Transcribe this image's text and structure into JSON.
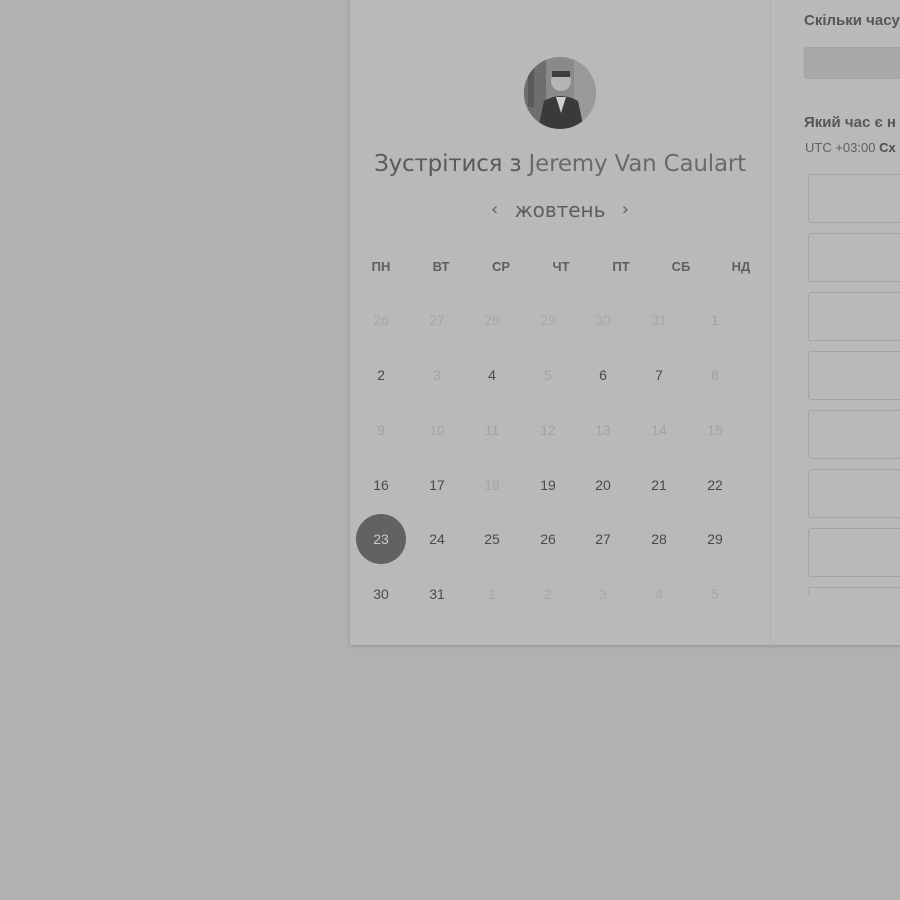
{
  "meeting": {
    "title_prefix": "Зустрітися з",
    "host_name": "Jeremy Van Caulart"
  },
  "calendar": {
    "month_label": "жовтень",
    "prev_icon": "‹",
    "next_icon": "›",
    "weekdays": [
      "ПН",
      "ВТ",
      "СР",
      "ЧТ",
      "ПТ",
      "СБ",
      "НД"
    ],
    "weeks": [
      [
        {
          "d": "26",
          "s": "outside"
        },
        {
          "d": "27",
          "s": "outside"
        },
        {
          "d": "28",
          "s": "outside"
        },
        {
          "d": "29",
          "s": "outside"
        },
        {
          "d": "30",
          "s": "outside"
        },
        {
          "d": "31",
          "s": "outside"
        },
        {
          "d": "1",
          "s": "unavailable"
        }
      ],
      [
        {
          "d": "2",
          "s": "available"
        },
        {
          "d": "3",
          "s": "unavailable"
        },
        {
          "d": "4",
          "s": "available"
        },
        {
          "d": "5",
          "s": "unavailable"
        },
        {
          "d": "6",
          "s": "available"
        },
        {
          "d": "7",
          "s": "available"
        },
        {
          "d": "8",
          "s": "unavailable"
        }
      ],
      [
        {
          "d": "9",
          "s": "unavailable"
        },
        {
          "d": "10",
          "s": "unavailable"
        },
        {
          "d": "11",
          "s": "unavailable"
        },
        {
          "d": "12",
          "s": "unavailable"
        },
        {
          "d": "13",
          "s": "unavailable"
        },
        {
          "d": "14",
          "s": "unavailable"
        },
        {
          "d": "15",
          "s": "unavailable"
        }
      ],
      [
        {
          "d": "16",
          "s": "available"
        },
        {
          "d": "17",
          "s": "available"
        },
        {
          "d": "18",
          "s": "unavailable"
        },
        {
          "d": "19",
          "s": "available"
        },
        {
          "d": "20",
          "s": "available"
        },
        {
          "d": "21",
          "s": "available"
        },
        {
          "d": "22",
          "s": "available"
        }
      ],
      [
        {
          "d": "23",
          "s": "selected"
        },
        {
          "d": "24",
          "s": "available"
        },
        {
          "d": "25",
          "s": "available"
        },
        {
          "d": "26",
          "s": "available"
        },
        {
          "d": "27",
          "s": "available"
        },
        {
          "d": "28",
          "s": "available"
        },
        {
          "d": "29",
          "s": "available"
        }
      ],
      [
        {
          "d": "30",
          "s": "available"
        },
        {
          "d": "31",
          "s": "available"
        },
        {
          "d": "1",
          "s": "outside"
        },
        {
          "d": "2",
          "s": "outside"
        },
        {
          "d": "3",
          "s": "outside"
        },
        {
          "d": "4",
          "s": "outside"
        },
        {
          "d": "5",
          "s": "outside"
        }
      ]
    ]
  },
  "right": {
    "duration_label": "Скільки часу",
    "time_label": "Який час є н",
    "timezone_offset": "UTC +03:00",
    "timezone_name": "Сх"
  }
}
